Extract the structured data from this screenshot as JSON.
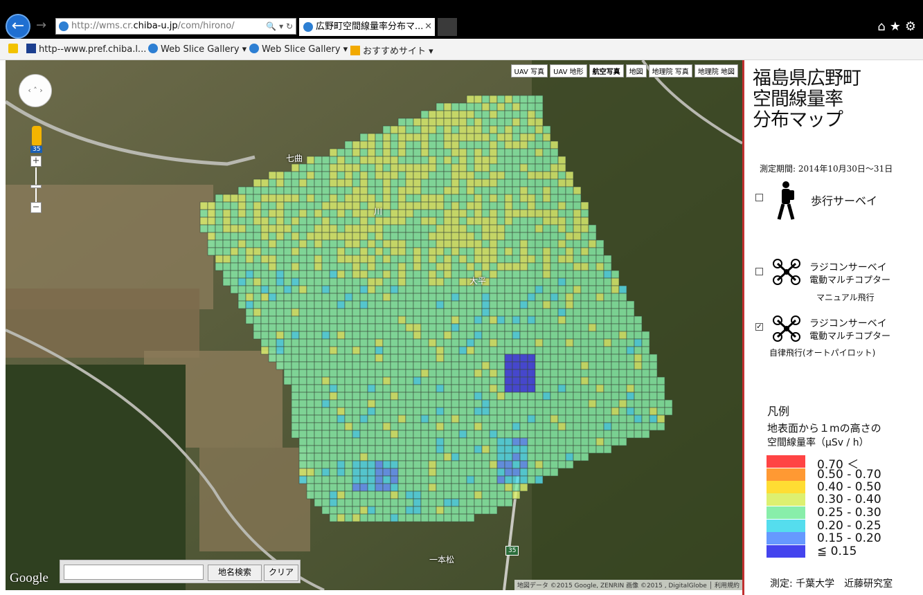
{
  "browser": {
    "url_prefix": "http://wms.cr.",
    "url_host": "chiba-u.jp",
    "url_suffix": "/com/hirono/",
    "tab_title": "広野町空間線量率分布マ...",
    "tab_close": "✕",
    "addr_tools": "🔍 ▾ ↻",
    "home_icon": "home-icon",
    "star_icon": "star-icon",
    "gear_icon": "gear-icon"
  },
  "favorites": [
    {
      "label": "http--www.pref.chiba.l...",
      "icon": "page-icon"
    },
    {
      "label": "Web Slice Gallery ▾",
      "icon": "ie-icon"
    },
    {
      "label": "Web Slice Gallery ▾",
      "icon": "ie-icon"
    },
    {
      "label": "おすすめサイト ▾",
      "icon": "bing-icon"
    }
  ],
  "map": {
    "types": [
      "UAV 写真",
      "UAV 地形",
      "航空写真",
      "地図",
      "地理院 写真",
      "地理院 地図"
    ],
    "active_type": "航空写真",
    "zoom_badge": "35",
    "zoom_in": "+",
    "zoom_out": "−",
    "place_labels": [
      "七曲",
      "川",
      "大平",
      "一本松"
    ],
    "road_number": "35",
    "logo": "Google",
    "search_placeholder": "",
    "search_button": "地名検索",
    "clear_button": "クリア",
    "attribution": "地図データ ©2015 Google, ZENRIN 画像 ©2015 , DigitalGlobe │ 利用規約"
  },
  "panel": {
    "title_lines": [
      "福島県広野町",
      "空間線量率",
      "分布マップ"
    ],
    "period": "測定期間: 2014年10月30日〜31日",
    "options": {
      "walk": {
        "label": "歩行サーベイ",
        "checked": false
      },
      "manual": {
        "line1": "ラジコンサーベイ",
        "line2": "電動マルチコプター",
        "sub": "マニュアル飛行",
        "checked": false
      },
      "auto": {
        "line1": "ラジコンサーベイ",
        "line2": "電動マルチコプター",
        "sub": "自律飛行(オートパイロット)",
        "checked": true
      }
    },
    "legend": {
      "title": "凡例",
      "desc1": "地表面から１mの高さの",
      "desc2": "空間線量率（μSv / h）",
      "items": [
        {
          "label": "0.70 ＜",
          "color": "#ff4444"
        },
        {
          "label": "0.50 - 0.70",
          "color": "#ff9933"
        },
        {
          "label": "0.40 - 0.50",
          "color": "#ffdd33"
        },
        {
          "label": "0.30 - 0.40",
          "color": "#ddf070"
        },
        {
          "label": "0.25 - 0.30",
          "color": "#88eeaa"
        },
        {
          "label": "0.20 - 0.25",
          "color": "#55ddee"
        },
        {
          "label": "0.15 - 0.20",
          "color": "#6699ff"
        },
        {
          "label": "≦ 0.15",
          "color": "#4444ee"
        }
      ]
    },
    "credit": "測定: 千葉大学　近藤研究室"
  }
}
